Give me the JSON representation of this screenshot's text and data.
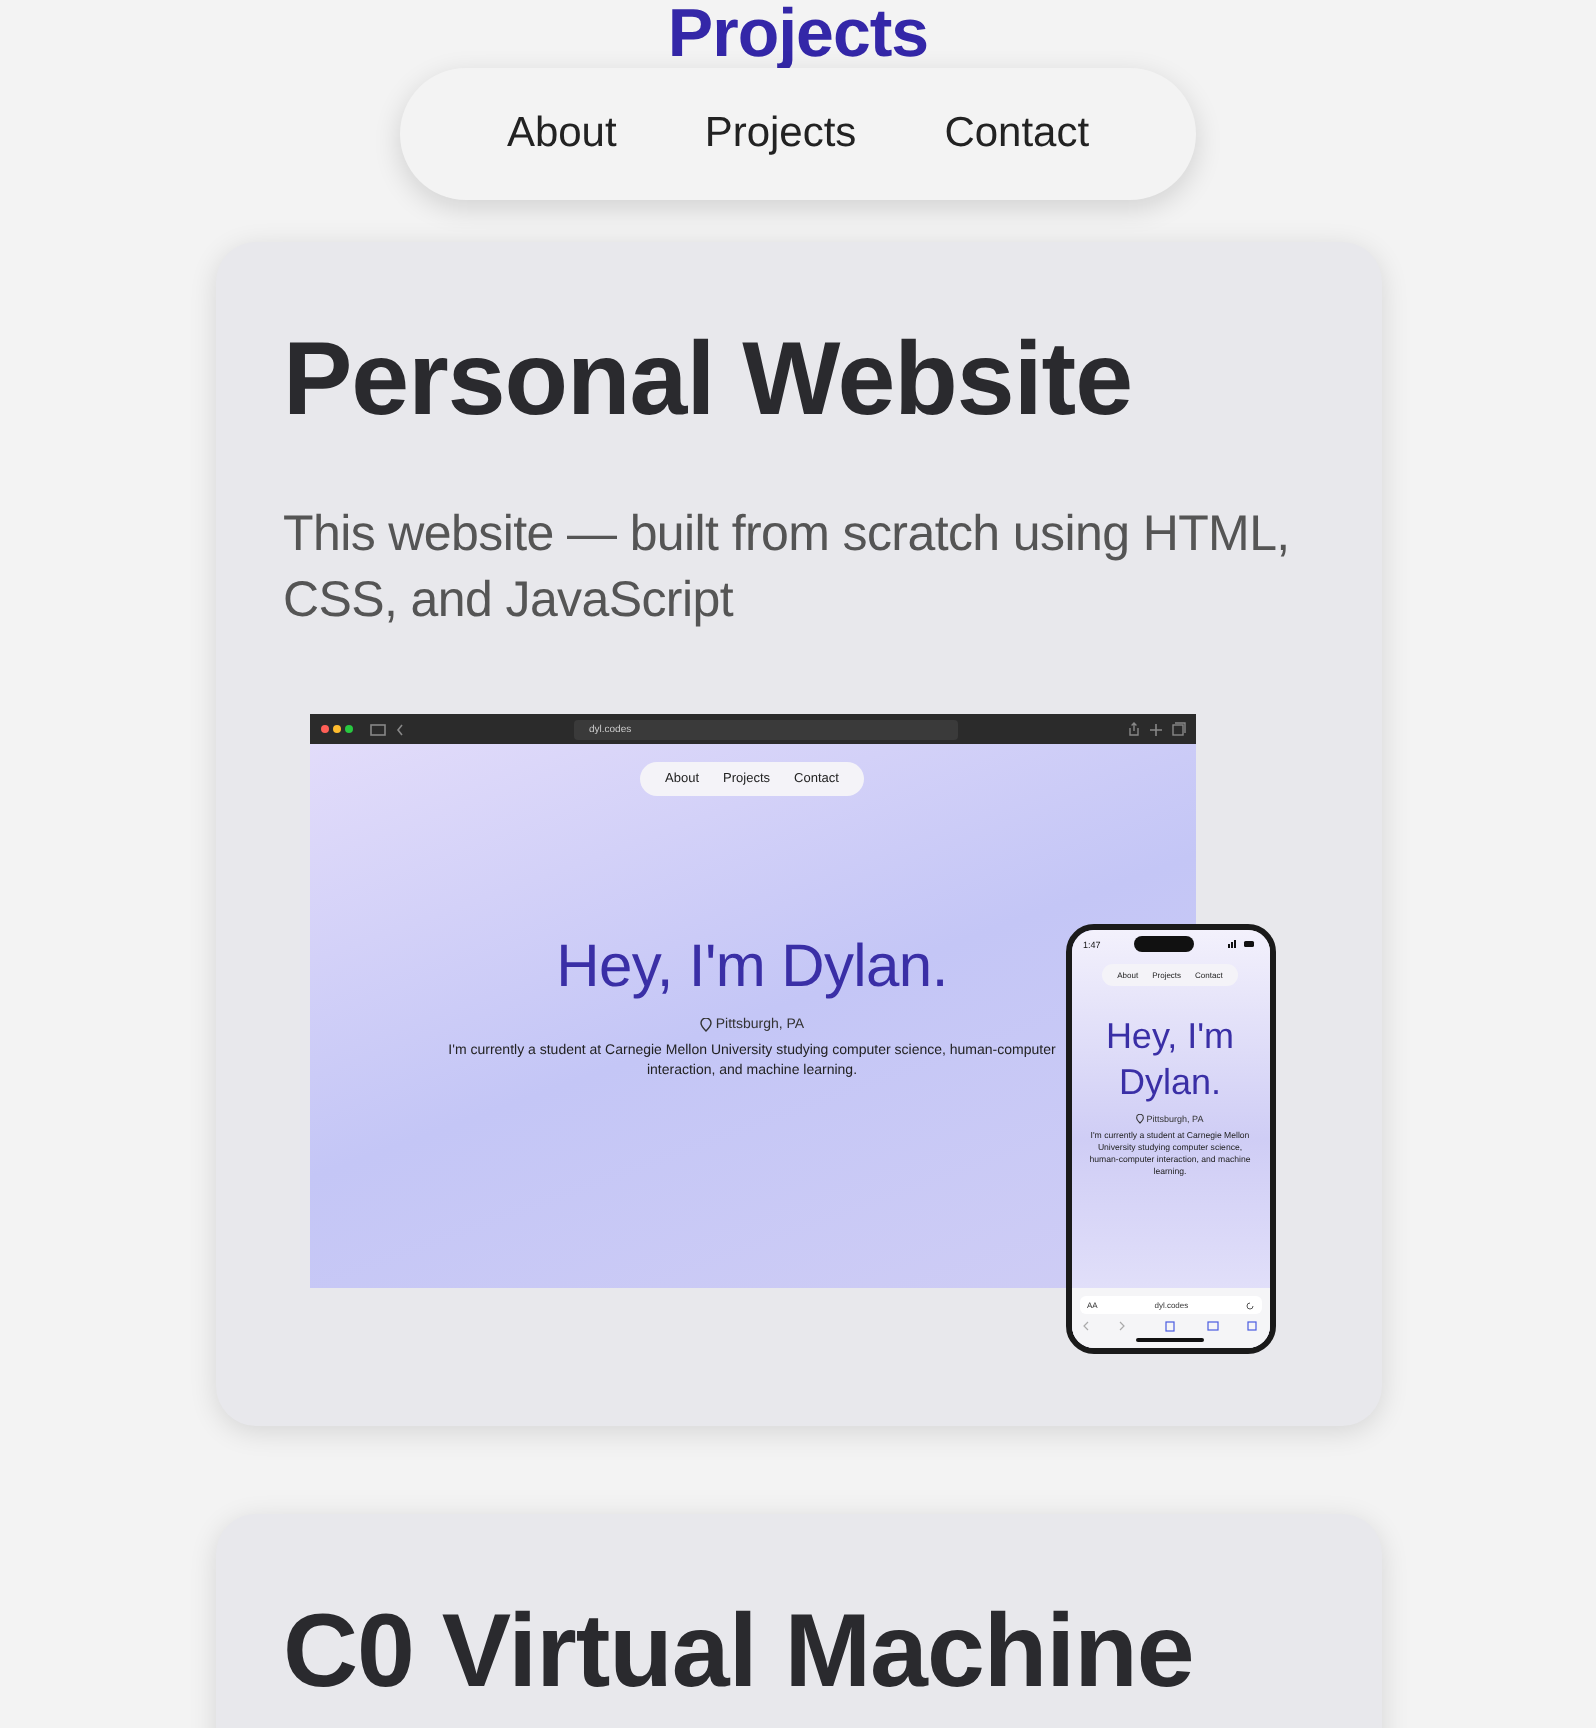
{
  "page_heading": "Projects",
  "nav": {
    "items": [
      {
        "label": "About"
      },
      {
        "label": "Projects"
      },
      {
        "label": "Contact"
      }
    ]
  },
  "projects": [
    {
      "title": "Personal Website",
      "description": "This website — built from scratch using HTML, CSS, and JavaScript",
      "preview": {
        "browser": {
          "url": "dyl.codes",
          "nav": [
            "About",
            "Projects",
            "Contact"
          ],
          "heading": "Hey, I'm Dylan.",
          "location": "Pittsburgh, PA",
          "bio": "I'm currently a student at Carnegie Mellon University studying computer science, human-computer interaction, and machine learning."
        },
        "phone": {
          "time": "1:47",
          "nav": [
            "About",
            "Projects",
            "Contact"
          ],
          "heading": "Hey, I'm Dylan.",
          "location": "Pittsburgh, PA",
          "bio": "I'm currently a student at Carnegie Mellon University studying computer science, human-computer interaction, and machine learning.",
          "text_size": "AA",
          "url": "dyl.codes"
        }
      }
    },
    {
      "title": "C0 Virtual Machine"
    }
  ]
}
